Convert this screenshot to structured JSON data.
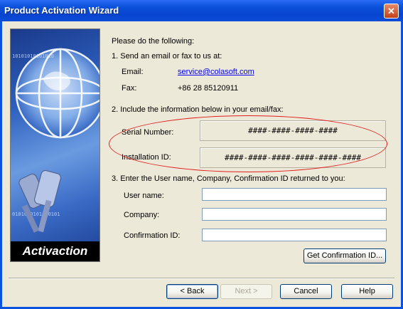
{
  "window": {
    "title": "Product Activation Wizard",
    "close_glyph": "✕"
  },
  "sidebar": {
    "label": "Activaction",
    "binary_text_1": "10101010101010",
    "binary_text_2": "0101010101010101"
  },
  "content": {
    "intro": "Please do the following:",
    "step1": "1. Send an email or fax to us at:",
    "email_label": "Email:",
    "email_value": "service@colasoft.com",
    "fax_label": "Fax:",
    "fax_value": "+86 28 85120911",
    "step2": "2. Include the information below in your email/fax:",
    "serial_label": "Serial Number:",
    "serial_value": "####-####-####-####",
    "install_label": "Installation ID:",
    "install_value": "####-####-####-####-####-####",
    "step3": "3. Enter the User name, Company, Confirmation ID returned to you:",
    "username_label": "User name:",
    "username_value": "",
    "company_label": "Company:",
    "company_value": "",
    "confirm_label": "Confirmation ID:",
    "confirm_value": "",
    "get_confirmation_button": "Get Confirmation ID..."
  },
  "footer": {
    "back": "< Back",
    "next": "Next >",
    "cancel": "Cancel",
    "help": "Help"
  },
  "colors": {
    "titlebar": "#0a4fd8",
    "client": "#ece9d8",
    "highlight_ellipse": "#e31c1c",
    "link": "#0000ee"
  }
}
